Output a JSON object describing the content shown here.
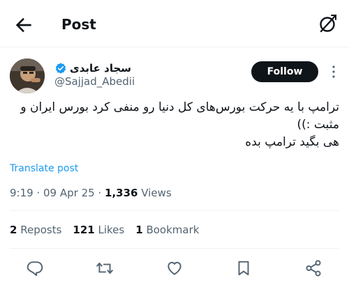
{
  "header": {
    "title": "Post",
    "back_icon": "arrow-left-icon",
    "grok_icon": "grok-icon"
  },
  "post": {
    "author": {
      "display_name": "سجاد عابدی",
      "handle": "@Sajjad_Abedii",
      "verified": true
    },
    "follow_label": "Follow",
    "text_lines": [
      "ترامپ با یه حرکت بورس‌های کل دنیا رو منفی کرد بورس ایران و",
      "مثبت :))",
      "هی بگید ترامپ بده"
    ],
    "translate_label": "Translate post",
    "time": "9:19",
    "date": "09 Apr 25",
    "views_count": "1,336",
    "views_label": "Views"
  },
  "stats": {
    "reposts_count": "2",
    "reposts_label": "Reposts",
    "likes_count": "121",
    "likes_label": "Likes",
    "bookmarks_count": "1",
    "bookmarks_label": "Bookmark"
  },
  "colors": {
    "accent": "#1d9bf0",
    "text_primary": "#0f1419",
    "text_secondary": "#536471",
    "divider": "#eff3f4"
  },
  "actions": [
    "reply-icon",
    "repost-icon",
    "like-icon",
    "bookmark-icon",
    "share-icon"
  ]
}
